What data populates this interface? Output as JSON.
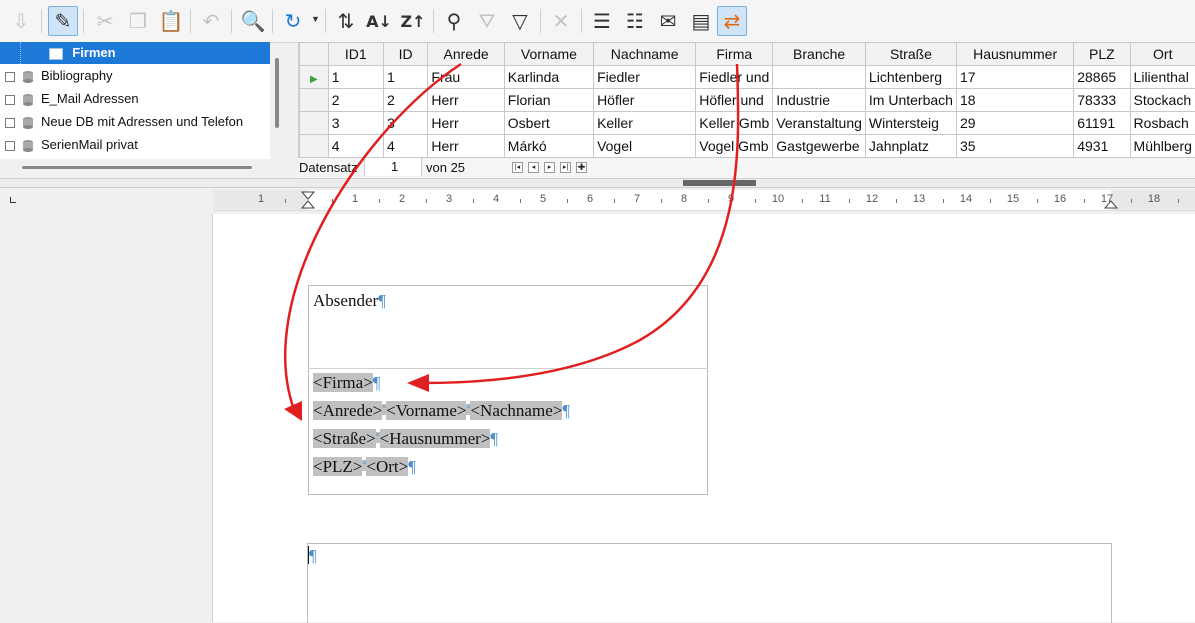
{
  "toolbar": {
    "buttons": [
      "import-icon",
      "edit-data-icon",
      "cut-icon",
      "copy-icon",
      "paste-icon",
      "undo-icon",
      "find-record-icon",
      "refresh-icon",
      "sort-icon",
      "sort-ascending-icon",
      "sort-descending-icon",
      "autofilter-icon",
      "apply-filter-icon",
      "standard-filter-icon",
      "reset-filter-icon",
      "data-to-text-icon",
      "data-to-fields-icon",
      "mail-merge-icon",
      "data-source-icon",
      "explorer-icon"
    ]
  },
  "tree": {
    "items": [
      {
        "label": "Firmen",
        "type": "table",
        "selected": true
      },
      {
        "label": "Bibliography",
        "type": "database"
      },
      {
        "label": "E_Mail Adressen",
        "type": "database"
      },
      {
        "label": "Neue DB mit Adressen und Telefon",
        "type": "database"
      },
      {
        "label": "SerienMail privat",
        "type": "database"
      }
    ]
  },
  "grid": {
    "columns": [
      "ID1",
      "ID",
      "Anrede",
      "Vorname",
      "Nachname",
      "Firma",
      "Branche",
      "Straße",
      "Hausnummer",
      "PLZ",
      "Ort"
    ],
    "rows": [
      [
        "1",
        "1",
        "Frau",
        "Karlinda",
        "Fiedler",
        "Fiedler und",
        "",
        "Lichtenberg",
        "17",
        "28865",
        "Lilienthal"
      ],
      [
        "2",
        "2",
        "Herr",
        "Florian",
        "Höfler",
        "Höfler und",
        "Industrie",
        "Im Unterbach",
        "18",
        "78333",
        "Stockach"
      ],
      [
        "3",
        "3",
        "Herr",
        "Osbert",
        "Keller",
        "Keller Gmb",
        "Veranstaltung",
        "Wintersteig",
        "29",
        "61191",
        "Rosbach"
      ],
      [
        "4",
        "4",
        "Herr",
        "Márkó",
        "Vogel",
        "Vogel Gmb",
        "Gastgewerbe",
        "Jahnplatz",
        "35",
        "4931",
        "Mühlberg"
      ]
    ],
    "current_row": 0
  },
  "navigation": {
    "record_label": "Datensatz",
    "record_value": "1",
    "of_label": "von 25"
  },
  "ruler": {
    "numbers": [
      "1",
      "1",
      "2",
      "3",
      "4",
      "5",
      "6",
      "7",
      "8",
      "9",
      "10",
      "11",
      "12",
      "13",
      "14",
      "15",
      "16",
      "17",
      "18"
    ]
  },
  "document": {
    "sender": "Absender",
    "lines": [
      [
        "<Firma>"
      ],
      [
        "<Anrede>",
        "<Vorname>",
        "<Nachname>"
      ],
      [
        "<Straße>",
        "<Hausnummer>"
      ],
      [
        "<PLZ>",
        "<Ort>"
      ]
    ],
    "pilcrow": "¶",
    "space_mark": "°"
  },
  "colors": {
    "selection": "#1e78d7",
    "arrow": "#e02020",
    "field_bg": "#c0c0c0",
    "format_mark": "#4a8fd0"
  }
}
